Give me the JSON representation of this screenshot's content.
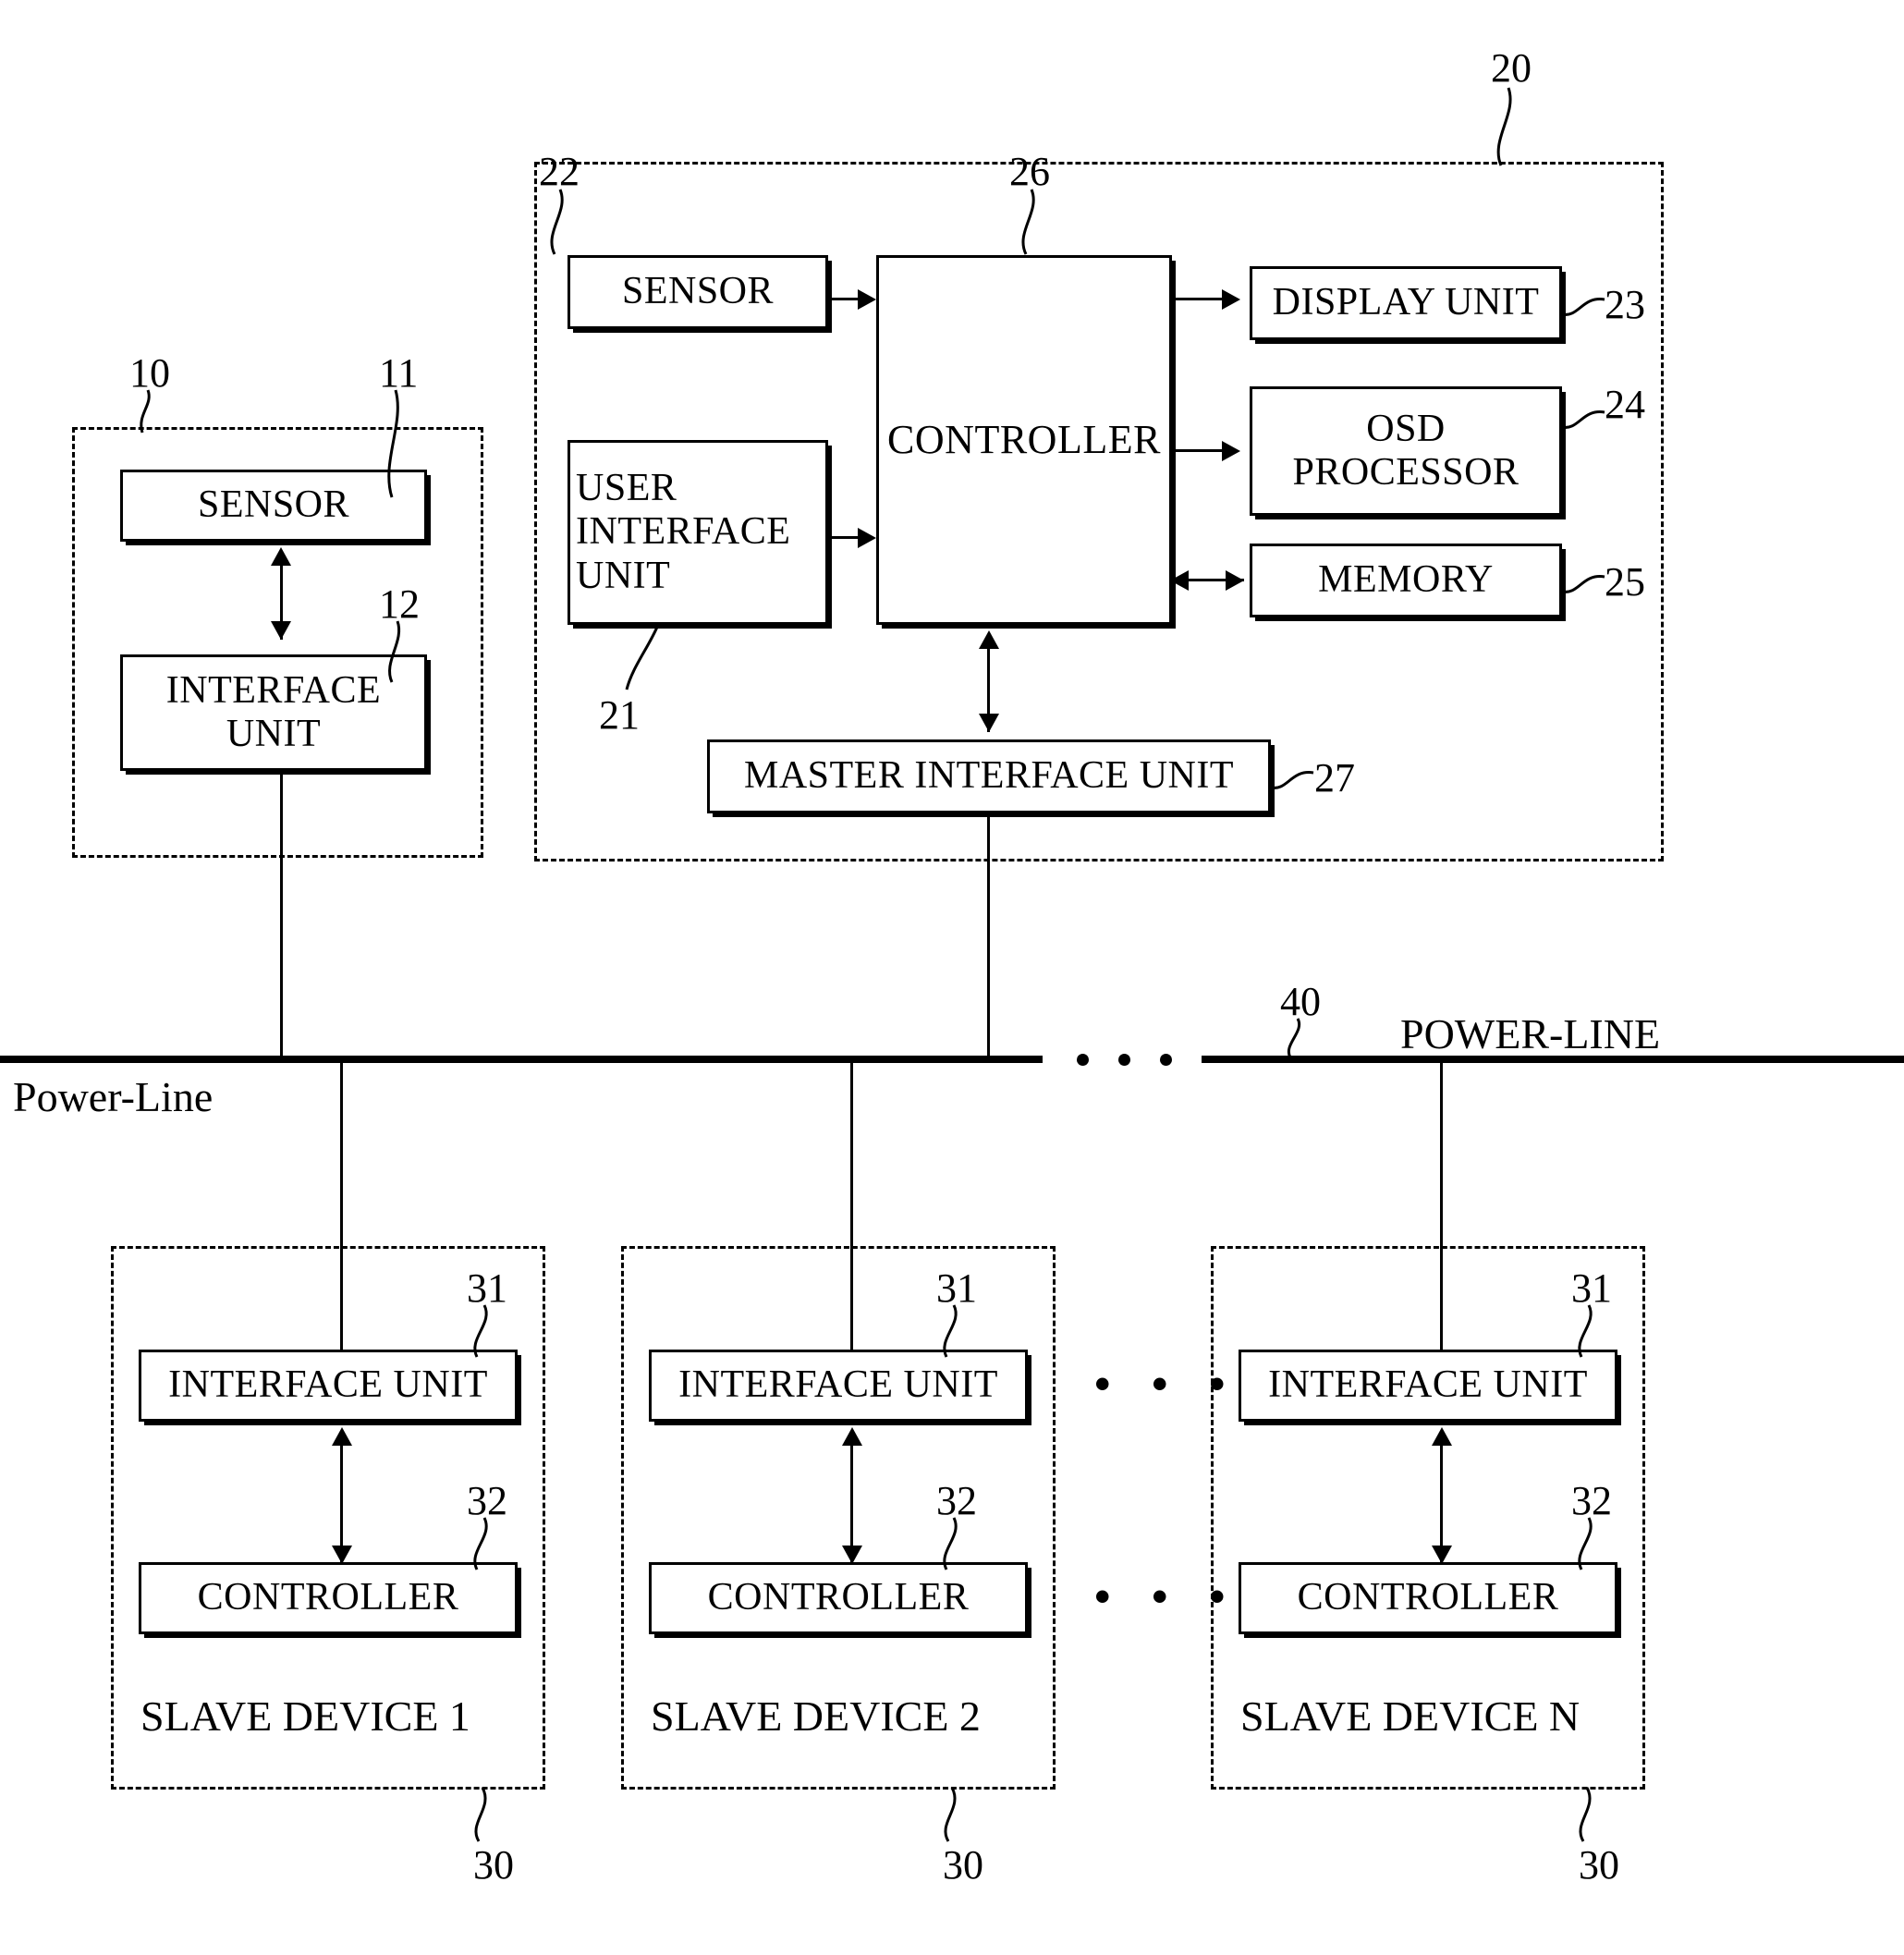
{
  "figure": {
    "type": "patent-block-diagram",
    "power_line_label_left": "Power-Line",
    "power_line_label_right": "POWER-LINE",
    "power_line_ref": "40",
    "ellipsis": "• • •"
  },
  "sensor_device": {
    "ref": "10",
    "blocks": [
      {
        "label": "SENSOR",
        "ref": "11"
      },
      {
        "label": "INTERFACE\nUNIT",
        "ref": "12"
      }
    ]
  },
  "master_device": {
    "ref": "20",
    "blocks": [
      {
        "label": "SENSOR",
        "ref": "22"
      },
      {
        "label": "USER\nINTERFACE\nUNIT",
        "ref": "21"
      },
      {
        "label": "CONTROLLER",
        "ref": "26"
      },
      {
        "label": "DISPLAY UNIT",
        "ref": "23"
      },
      {
        "label": "OSD\nPROCESSOR",
        "ref": "24"
      },
      {
        "label": "MEMORY",
        "ref": "25"
      },
      {
        "label": "MASTER INTERFACE UNIT",
        "ref": "27"
      }
    ]
  },
  "slave_devices": [
    {
      "title": "SLAVE DEVICE 1",
      "ref": "30",
      "blocks": [
        {
          "label": "INTERFACE UNIT",
          "ref": "31"
        },
        {
          "label": "CONTROLLER",
          "ref": "32"
        }
      ]
    },
    {
      "title": "SLAVE DEVICE 2",
      "ref": "30",
      "blocks": [
        {
          "label": "INTERFACE UNIT",
          "ref": "31"
        },
        {
          "label": "CONTROLLER",
          "ref": "32"
        }
      ]
    },
    {
      "title": "SLAVE DEVICE N",
      "ref": "30",
      "blocks": [
        {
          "label": "INTERFACE UNIT",
          "ref": "31"
        },
        {
          "label": "CONTROLLER",
          "ref": "32"
        }
      ]
    }
  ]
}
